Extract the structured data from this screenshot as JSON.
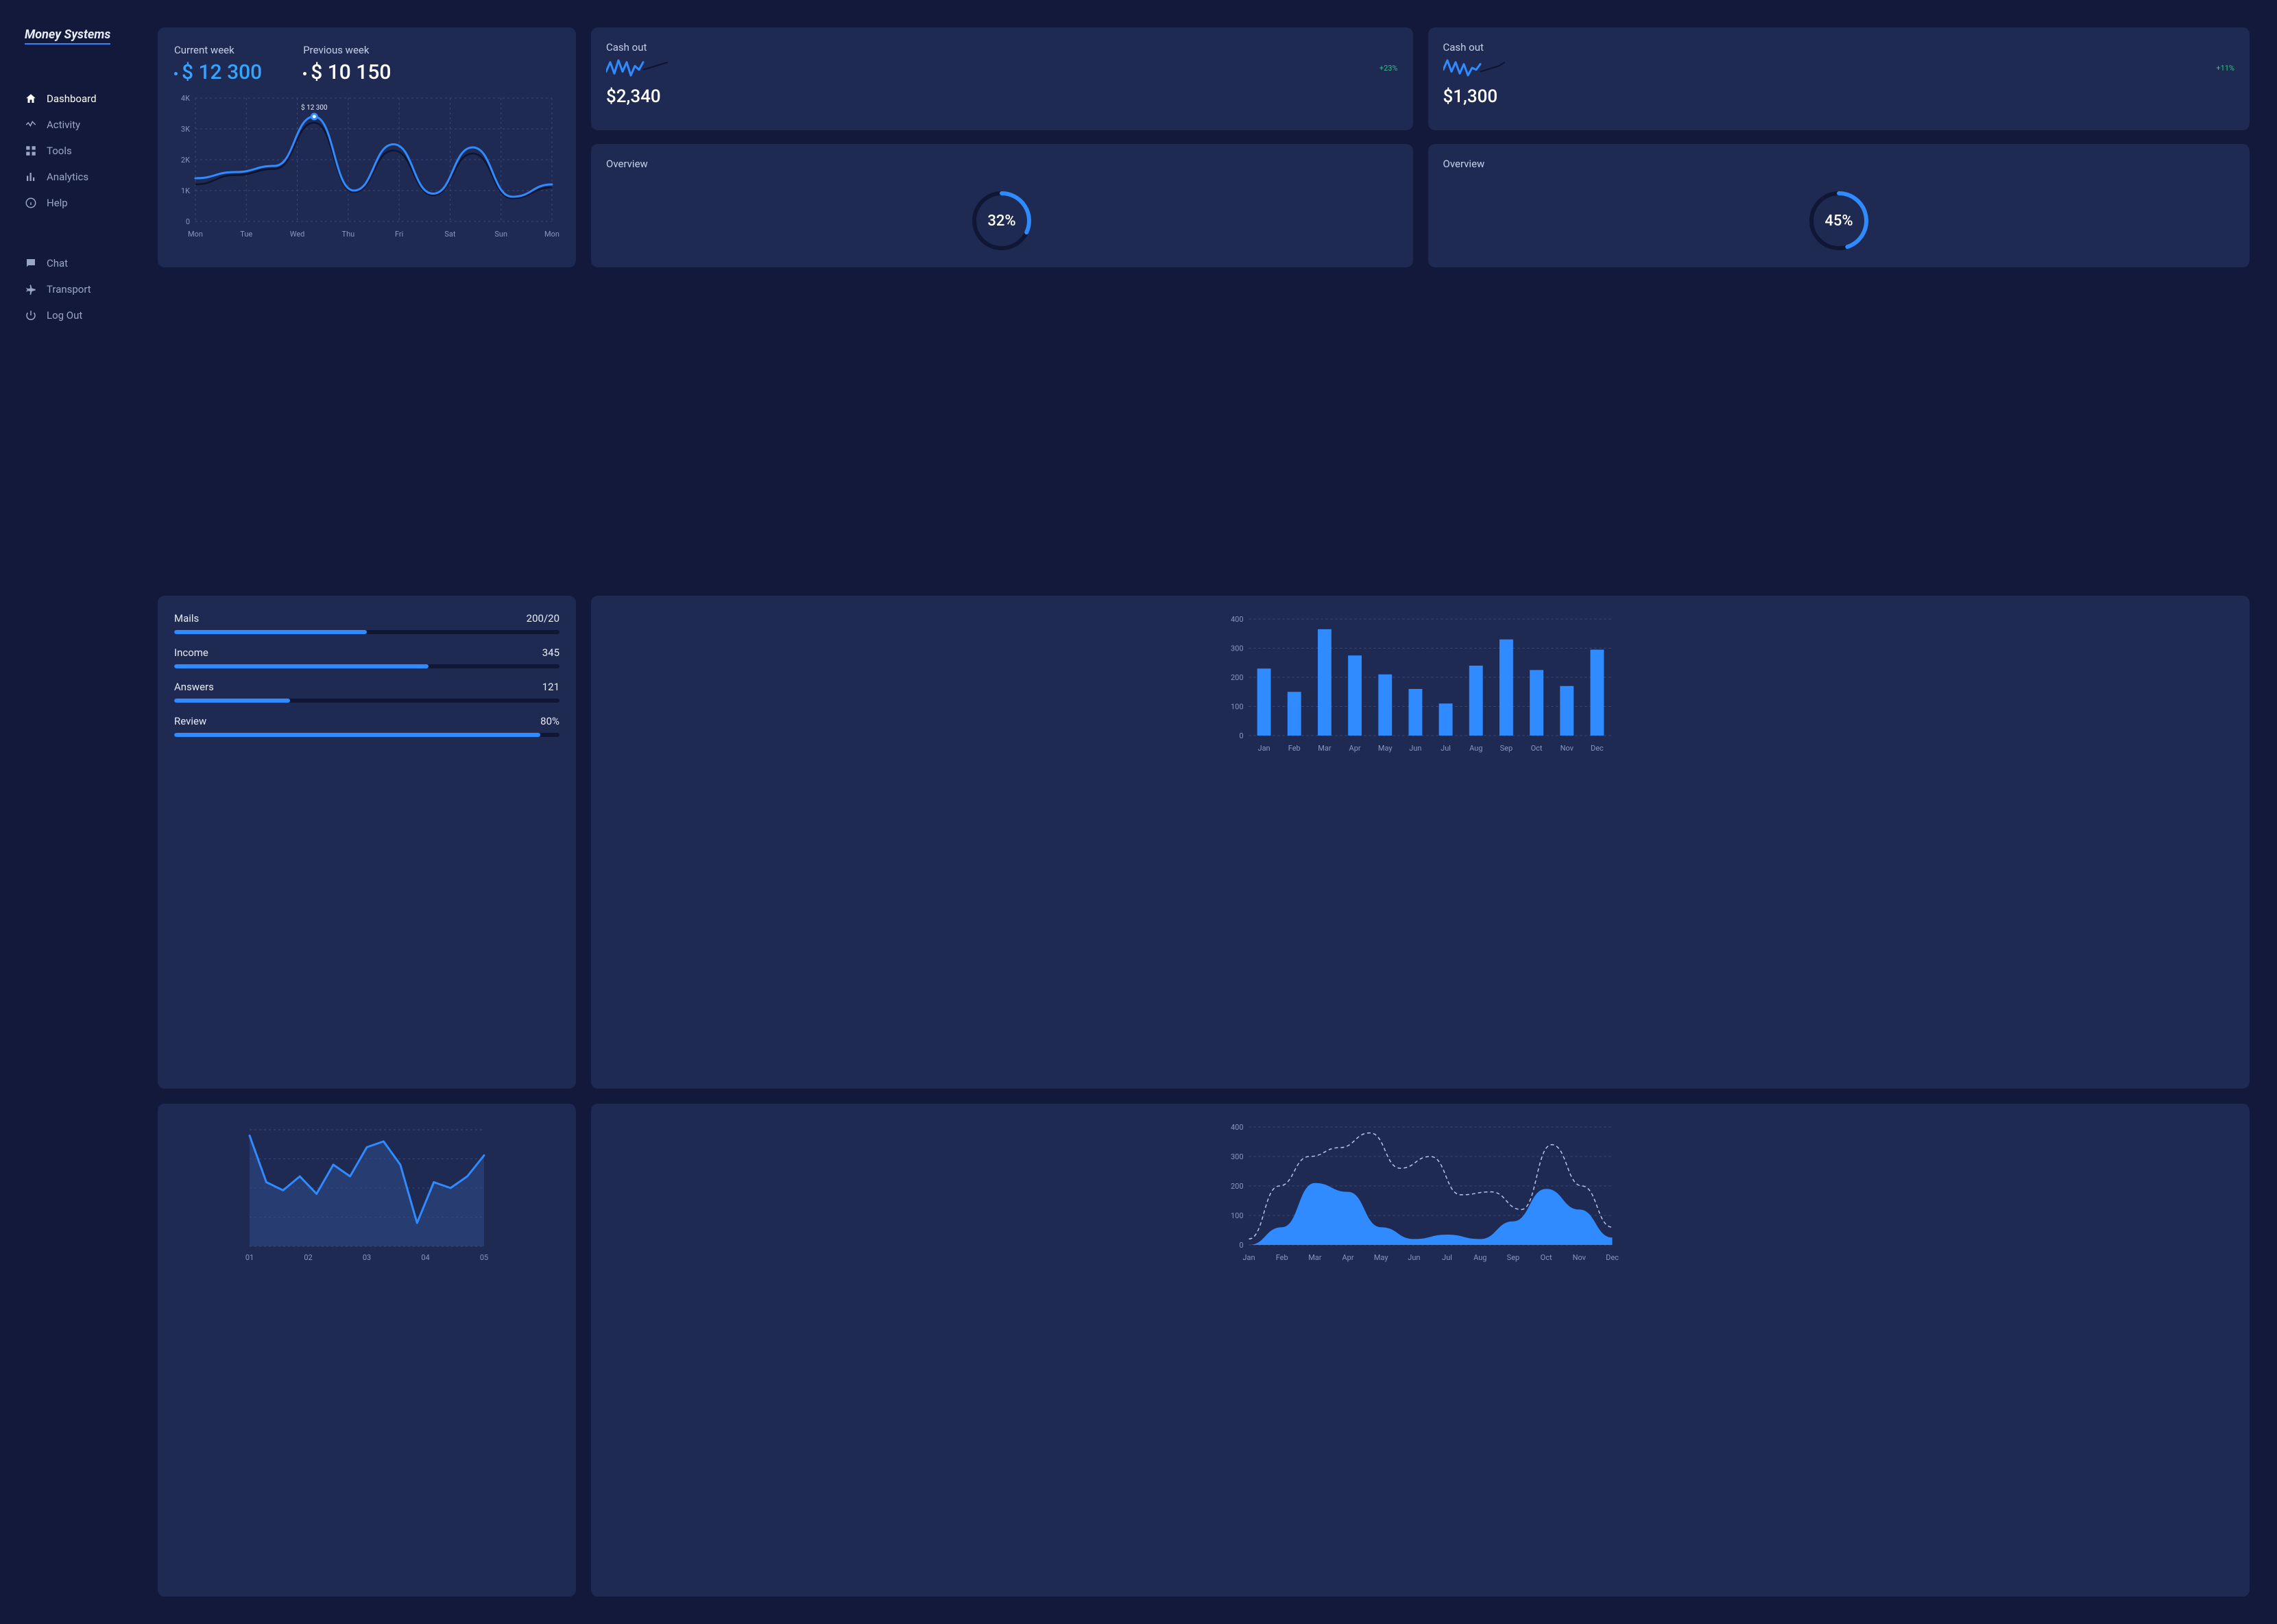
{
  "brand": "Money Systems",
  "sidebar": {
    "primary": [
      {
        "label": "Dashboard"
      },
      {
        "label": "Activity"
      },
      {
        "label": "Tools"
      },
      {
        "label": "Analytics"
      },
      {
        "label": "Help"
      }
    ],
    "secondary": [
      {
        "label": "Chat"
      },
      {
        "label": "Transport"
      },
      {
        "label": "Log Out"
      }
    ]
  },
  "week_summary": {
    "current_label": "Current week",
    "current_value": "$ 12 300",
    "previous_label": "Previous week",
    "previous_value": "$ 10 150",
    "tooltip": "$ 12 300"
  },
  "cashout_1": {
    "title": "Cash out",
    "delta": "+23%",
    "value": "$2,340"
  },
  "cashout_2": {
    "title": "Cash out",
    "delta": "+11%",
    "value": "$1,300"
  },
  "overview_1": {
    "title": "Overview",
    "pct": "32%"
  },
  "overview_2": {
    "title": "Overview",
    "pct": "45%"
  },
  "progress": [
    {
      "label": "Mails",
      "value": "200/20",
      "fill": 50
    },
    {
      "label": "Income",
      "value": "345",
      "fill": 66
    },
    {
      "label": "Answers",
      "value": "121",
      "fill": 30
    },
    {
      "label": "Review",
      "value": "80%",
      "fill": 95
    }
  ],
  "chart_data": {
    "week_line": {
      "type": "line",
      "categories": [
        "Mon",
        "Tue",
        "Wed",
        "Thu",
        "Fri",
        "Sat",
        "Sun",
        "Mon"
      ],
      "series": [
        {
          "name": "Current week",
          "values": [
            1400,
            1600,
            1800,
            3400,
            1000,
            2500,
            900,
            2400,
            800,
            1200
          ]
        }
      ],
      "background_series": {
        "name": "Previous week (implied)",
        "values": [
          1200,
          1500,
          1700,
          3200,
          950,
          2300,
          850,
          2200,
          750,
          1100
        ]
      },
      "highlight_point": {
        "x_index": 3,
        "label": "$ 12 300",
        "value": 3400
      },
      "ylabel": "",
      "y_ticks": [
        0,
        "1K",
        "2K",
        "3K",
        "4K"
      ],
      "ylim": [
        0,
        4000
      ]
    },
    "monthly_bars": {
      "type": "bar",
      "categories": [
        "Jan",
        "Feb",
        "Mar",
        "Apr",
        "May",
        "Jun",
        "Jul",
        "Aug",
        "Sep",
        "Oct",
        "Nov",
        "Dec"
      ],
      "values": [
        230,
        150,
        365,
        275,
        210,
        160,
        110,
        240,
        330,
        225,
        170,
        295
      ],
      "ylabel": "",
      "ylim": [
        0,
        400
      ],
      "y_ticks": [
        0,
        100,
        200,
        300,
        400
      ]
    },
    "small_area": {
      "type": "area",
      "categories": [
        "01",
        "02",
        "03",
        "04",
        "05"
      ],
      "values": [
        95,
        55,
        48,
        60,
        45,
        70,
        60,
        85,
        90,
        70,
        20,
        55,
        50,
        60,
        78
      ],
      "ylim": [
        0,
        100
      ]
    },
    "large_area": {
      "type": "area",
      "categories": [
        "Jan",
        "Feb",
        "Mar",
        "Apr",
        "May",
        "Jun",
        "Jul",
        "Aug",
        "Sep",
        "Oct",
        "Nov",
        "Dec"
      ],
      "series": [
        {
          "name": "filled",
          "values": [
            0,
            60,
            210,
            180,
            60,
            20,
            35,
            20,
            80,
            190,
            120,
            25
          ]
        },
        {
          "name": "dashed",
          "values": [
            20,
            200,
            300,
            330,
            380,
            260,
            300,
            170,
            180,
            120,
            340,
            200,
            60
          ]
        }
      ],
      "ylabel": "",
      "ylim": [
        0,
        400
      ],
      "y_ticks": [
        0,
        100,
        200,
        300,
        400
      ]
    },
    "cashout_spark_1": {
      "type": "line",
      "values": [
        5,
        10,
        4,
        11,
        5,
        10,
        3,
        8,
        6,
        10
      ],
      "trend_values": [
        6,
        7,
        8,
        9,
        10
      ]
    },
    "cashout_spark_2": {
      "type": "line",
      "values": [
        6,
        11,
        5,
        10,
        4,
        9,
        3,
        7,
        6,
        9
      ],
      "trend_values": [
        5,
        6,
        7,
        8,
        10
      ]
    },
    "overview_radial_1": {
      "type": "radial",
      "percent": 32
    },
    "overview_radial_2": {
      "type": "radial",
      "percent": 45
    }
  }
}
